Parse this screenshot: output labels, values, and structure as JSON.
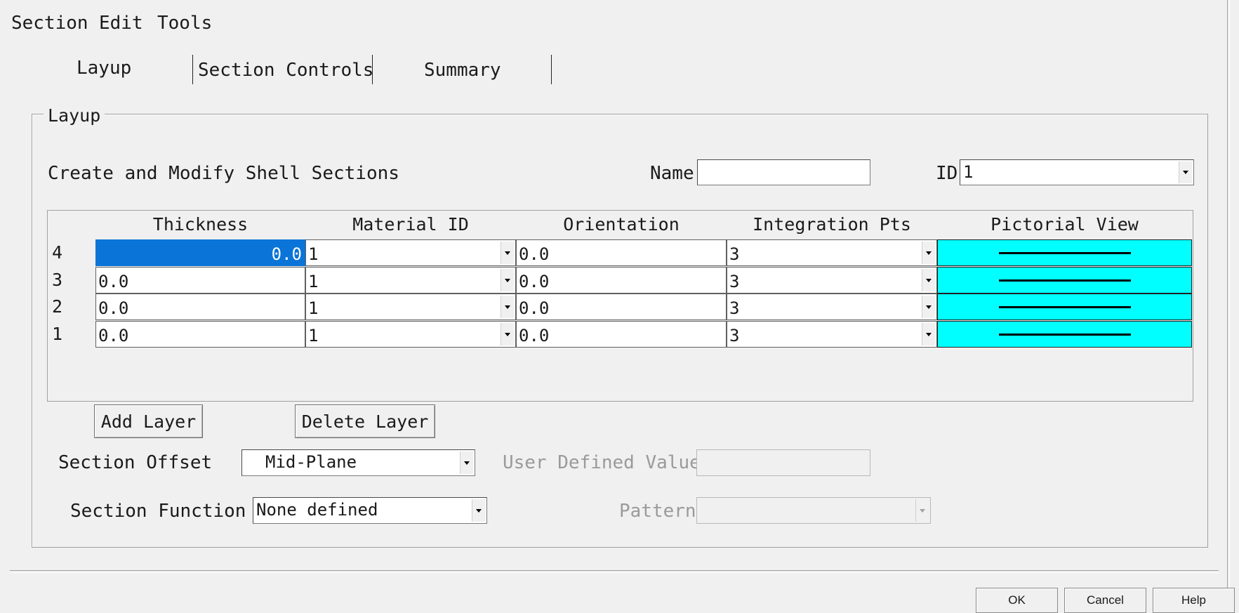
{
  "menu": [
    "Section",
    "Edit",
    "Tools"
  ],
  "tabs": [
    {
      "label": "Layup",
      "active": true
    },
    {
      "label": "Section Controls",
      "active": false
    },
    {
      "label": "Summary",
      "active": false
    }
  ],
  "group_title": "Layup",
  "heading": "Create and Modify Shell Sections",
  "name": {
    "label": "Name",
    "value": ""
  },
  "id": {
    "label": "ID",
    "value": "1"
  },
  "table": {
    "columns": [
      "Thickness",
      "Material ID",
      "Orientation",
      "Integration Pts",
      "Pictorial View"
    ],
    "rows": [
      {
        "label": "4",
        "thickness": "0.0",
        "material": "1",
        "orientation": "0.0",
        "integration": "3"
      },
      {
        "label": "3",
        "thickness": "0.0",
        "material": "1",
        "orientation": "0.0",
        "integration": "3"
      },
      {
        "label": "2",
        "thickness": "0.0",
        "material": "1",
        "orientation": "0.0",
        "integration": "3"
      },
      {
        "label": "1",
        "thickness": "0.0",
        "material": "1",
        "orientation": "0.0",
        "integration": "3"
      }
    ]
  },
  "buttons": {
    "add_layer": "Add Layer",
    "delete_layer": "Delete Layer"
  },
  "section_offset": {
    "label": "Section Offset",
    "value": "Mid-Plane"
  },
  "user_defined": {
    "label": "User Defined Value",
    "value": ""
  },
  "section_function": {
    "label": "Section Function",
    "value": "None defined"
  },
  "pattern": {
    "label": "Pattern",
    "value": ""
  },
  "dialog": {
    "ok": "OK",
    "cancel": "Cancel",
    "help": "Help"
  },
  "colors": {
    "selection": "#0a74d8",
    "pictorial": "#00ffff",
    "background": "#f0f0f0"
  }
}
